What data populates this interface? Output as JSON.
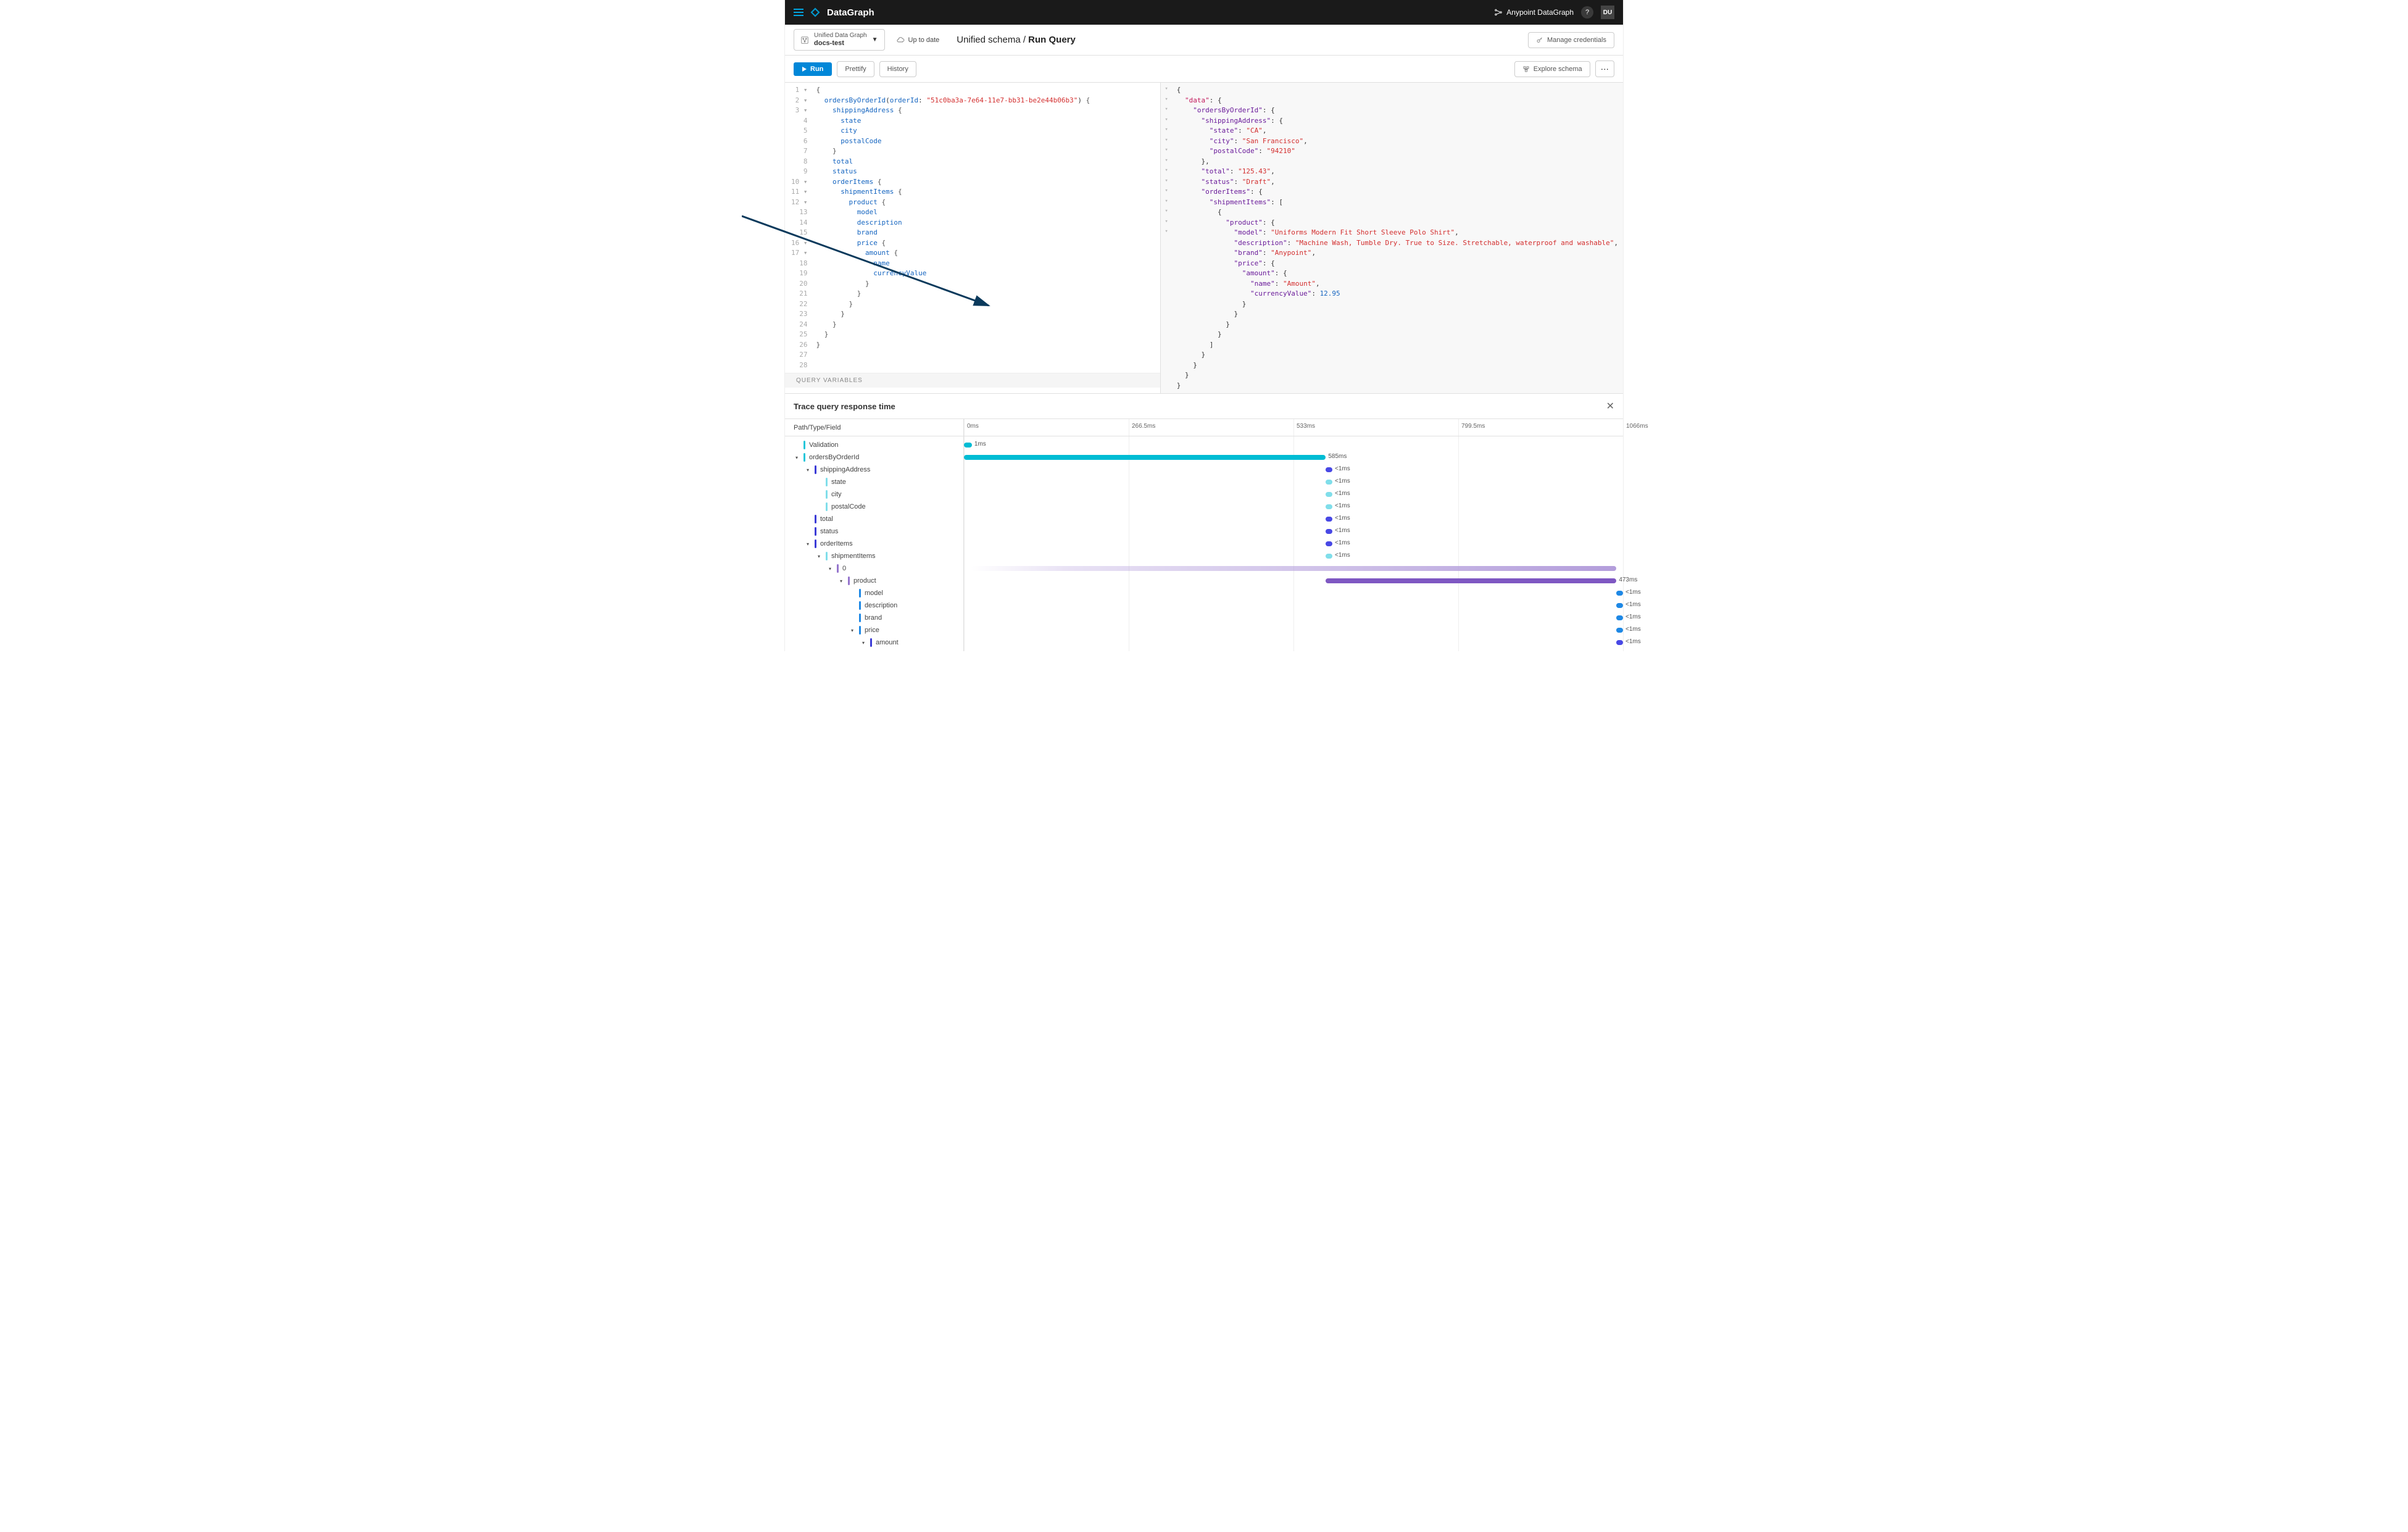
{
  "header": {
    "brand": "DataGraph",
    "product_link": "Anypoint DataGraph",
    "help_symbol": "?",
    "user_initials": "DU"
  },
  "subheader": {
    "project": {
      "line1": "Unified Data Graph",
      "line2": "docs-test"
    },
    "sync_status": "Up to date",
    "breadcrumb_prefix": "Unified schema / ",
    "breadcrumb_current": "Run Query",
    "manage_credentials": "Manage credentials"
  },
  "toolbar": {
    "run": "Run",
    "prettify": "Prettify",
    "history": "History",
    "explore_schema": "Explore schema",
    "more": "···"
  },
  "query_editor": {
    "lines": [
      "{",
      "  ordersByOrderId(orderId: \"51c0ba3a-7e64-11e7-bb31-be2e44b06b3\") {",
      "    shippingAddress {",
      "      state",
      "      city",
      "      postalCode",
      "    }",
      "    total",
      "    status",
      "    orderItems {",
      "      shipmentItems {",
      "        product {",
      "          model",
      "          description",
      "          brand",
      "          price {",
      "            amount {",
      "              name",
      "              currencyValue",
      "            }",
      "          }",
      "        }",
      "      }",
      "    }",
      "  }",
      "}",
      "",
      ""
    ],
    "query_variables_label": "QUERY VARIABLES"
  },
  "result": {
    "json": {
      "data": {
        "ordersByOrderId": {
          "shippingAddress": {
            "state": "CA",
            "city": "San Francisco",
            "postalCode": "94210"
          },
          "total": "125.43",
          "status": "Draft",
          "orderItems": {
            "shipmentItems": [
              {
                "product": {
                  "model": "Uniforms Modern Fit Short Sleeve Polo Shirt",
                  "description": "Machine Wash, Tumble Dry. True to Size. Stretchable, waterproof and washable",
                  "brand": "Anypoint",
                  "price": {
                    "amount": {
                      "name": "Amount",
                      "currencyValue": 12.95
                    }
                  }
                }
              }
            ]
          }
        }
      }
    }
  },
  "trace": {
    "title": "Trace query response time",
    "path_col_header": "Path/Type/Field",
    "ticks": [
      "0ms",
      "266.5ms",
      "533ms",
      "799.5ms",
      "1066ms"
    ],
    "rows": [
      {
        "depth": 0,
        "toggle": "",
        "pill": "c-cyan",
        "label": "Validation",
        "bar": {
          "cls": "bg-cyan",
          "left": 0,
          "width": 1.2,
          "text": "1ms",
          "tpos": "right"
        }
      },
      {
        "depth": 0,
        "toggle": "v",
        "pill": "c-cyan",
        "label": "ordersByOrderId",
        "bar": {
          "cls": "bg-cyan",
          "left": 0,
          "width": 54.9,
          "text": "585ms",
          "tpos": "right"
        }
      },
      {
        "depth": 1,
        "toggle": "v",
        "pill": "c-dkblue",
        "label": "shippingAddress",
        "bar": {
          "cls": "bg-dkblue",
          "left": 54.9,
          "width": 1.0,
          "text": "<1ms",
          "tpos": "right"
        }
      },
      {
        "depth": 2,
        "toggle": "",
        "pill": "c-ltcyan",
        "label": "state",
        "bar": {
          "cls": "bg-ltcyan",
          "left": 54.9,
          "width": 1.0,
          "text": "<1ms",
          "tpos": "right"
        }
      },
      {
        "depth": 2,
        "toggle": "",
        "pill": "c-ltcyan",
        "label": "city",
        "bar": {
          "cls": "bg-ltcyan",
          "left": 54.9,
          "width": 1.0,
          "text": "<1ms",
          "tpos": "right"
        }
      },
      {
        "depth": 2,
        "toggle": "",
        "pill": "c-ltcyan",
        "label": "postalCode",
        "bar": {
          "cls": "bg-ltcyan",
          "left": 54.9,
          "width": 1.0,
          "text": "<1ms",
          "tpos": "right"
        }
      },
      {
        "depth": 1,
        "toggle": "",
        "pill": "c-dkblue",
        "label": "total",
        "bar": {
          "cls": "bg-dkblue",
          "left": 54.9,
          "width": 1.0,
          "text": "<1ms",
          "tpos": "right"
        }
      },
      {
        "depth": 1,
        "toggle": "",
        "pill": "c-dkblue",
        "label": "status",
        "bar": {
          "cls": "bg-dkblue",
          "left": 54.9,
          "width": 1.0,
          "text": "<1ms",
          "tpos": "right"
        }
      },
      {
        "depth": 1,
        "toggle": "v",
        "pill": "c-dkblue",
        "label": "orderItems",
        "bar": {
          "cls": "bg-dkblue",
          "left": 54.9,
          "width": 1.0,
          "text": "<1ms",
          "tpos": "right"
        }
      },
      {
        "depth": 2,
        "toggle": "v",
        "pill": "c-ltcyan",
        "label": "shipmentItems",
        "bar": {
          "cls": "bg-ltcyan",
          "left": 54.9,
          "width": 1.0,
          "text": "<1ms",
          "tpos": "right"
        }
      },
      {
        "depth": 3,
        "toggle": "v",
        "pill": "c-purple",
        "label": "0",
        "bar": {
          "cls": "grad",
          "left": 1,
          "width": 98.0,
          "text": "",
          "tpos": ""
        }
      },
      {
        "depth": 4,
        "toggle": "v",
        "pill": "c-purple",
        "label": "product",
        "bar": {
          "cls": "bg-purple",
          "left": 54.9,
          "width": 44.1,
          "text": "473ms",
          "tpos": "right"
        }
      },
      {
        "depth": 5,
        "toggle": "",
        "pill": "c-blue",
        "label": "model",
        "bar": {
          "cls": "bg-blue",
          "left": 99.0,
          "width": 1.0,
          "text": "<1ms",
          "tpos": "right"
        }
      },
      {
        "depth": 5,
        "toggle": "",
        "pill": "c-blue",
        "label": "description",
        "bar": {
          "cls": "bg-blue",
          "left": 99.0,
          "width": 1.0,
          "text": "<1ms",
          "tpos": "right"
        }
      },
      {
        "depth": 5,
        "toggle": "",
        "pill": "c-blue",
        "label": "brand",
        "bar": {
          "cls": "bg-blue",
          "left": 99.0,
          "width": 1.0,
          "text": "<1ms",
          "tpos": "right"
        }
      },
      {
        "depth": 5,
        "toggle": "v",
        "pill": "c-blue",
        "label": "price",
        "bar": {
          "cls": "bg-blue",
          "left": 99.0,
          "width": 1.0,
          "text": "<1ms",
          "tpos": "right"
        }
      },
      {
        "depth": 6,
        "toggle": "v",
        "pill": "c-dkblue",
        "label": "amount",
        "bar": {
          "cls": "bg-dkblue",
          "left": 99.0,
          "width": 1.0,
          "text": "<1ms",
          "tpos": "right"
        }
      }
    ]
  }
}
